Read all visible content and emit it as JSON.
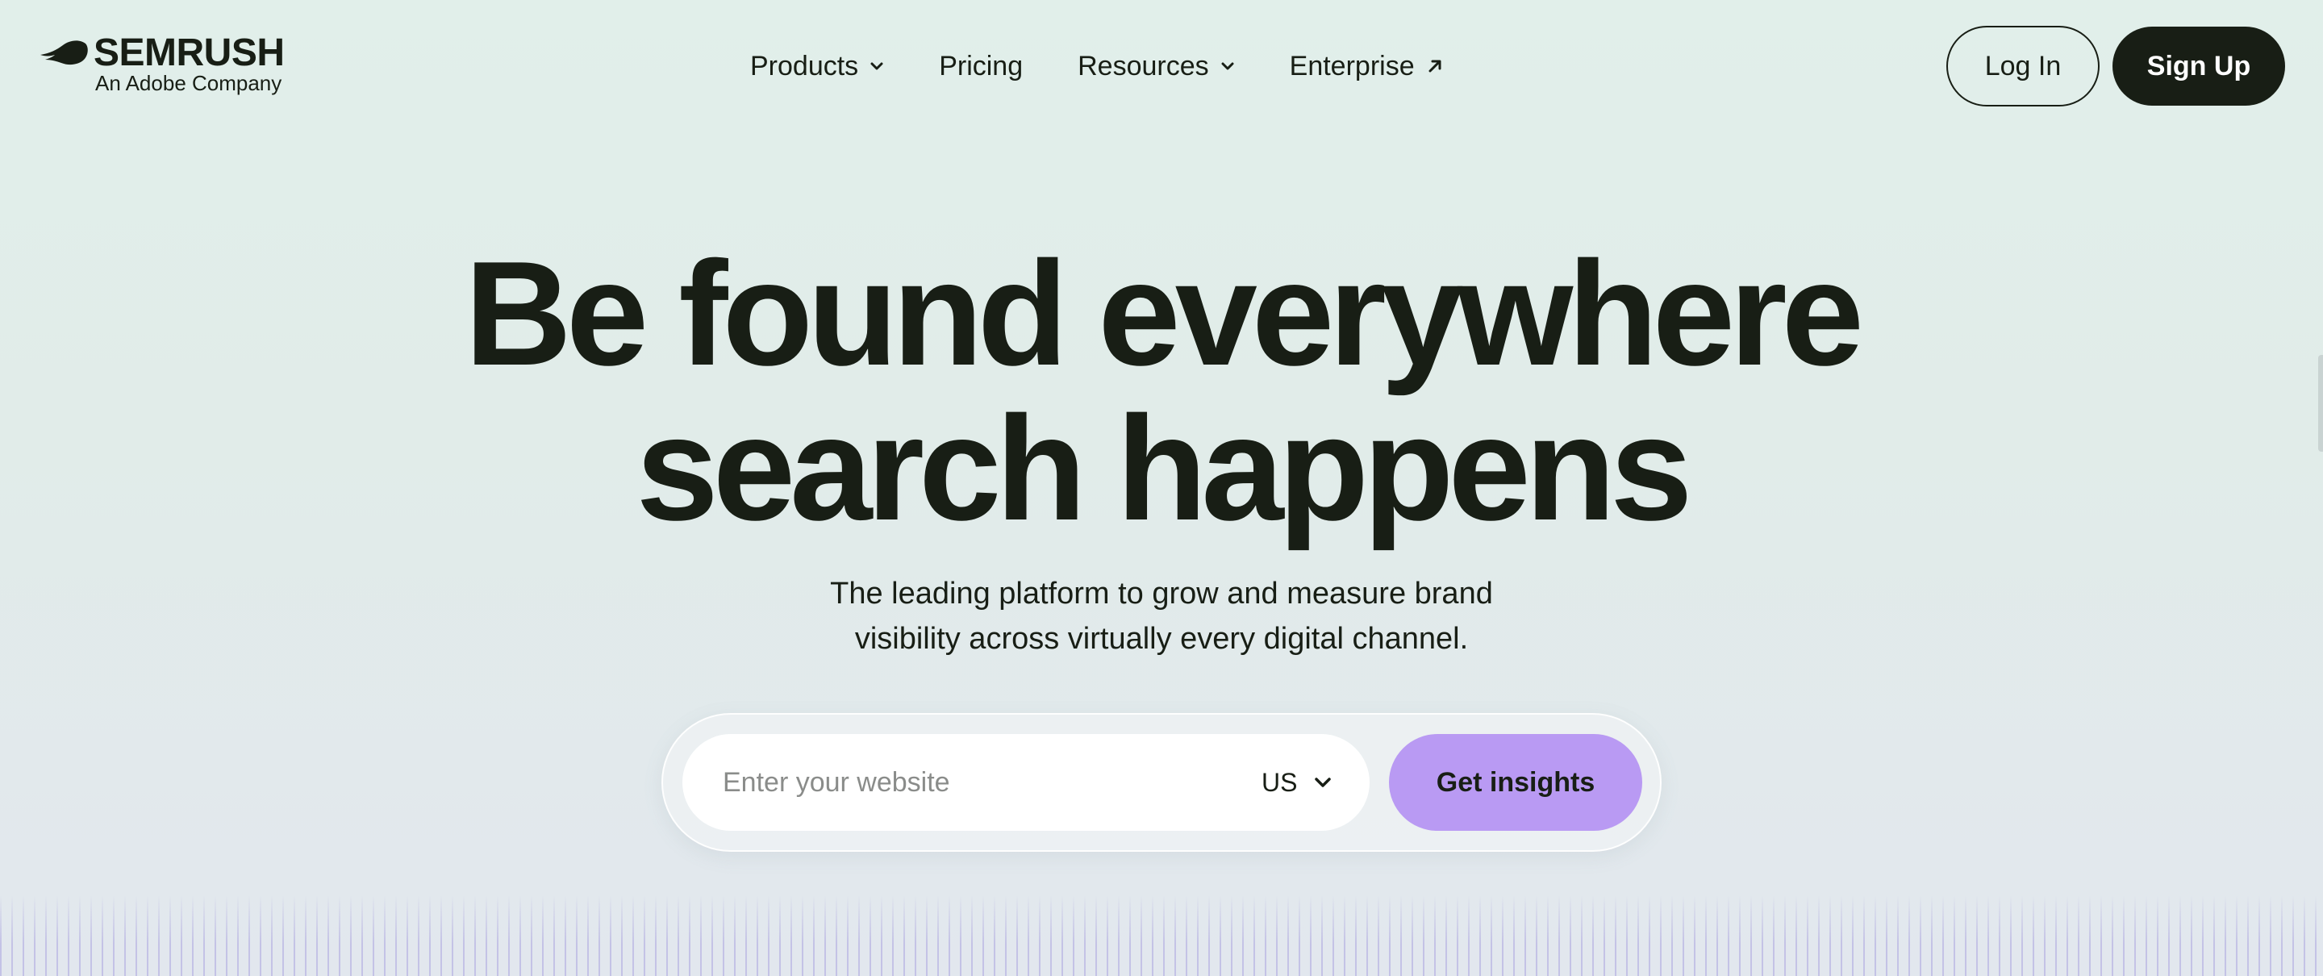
{
  "brand": {
    "name": "SEMRUSH",
    "tagline": "An Adobe Company"
  },
  "nav": {
    "items": [
      {
        "label": "Products",
        "icon": "chevron-down-icon"
      },
      {
        "label": "Pricing",
        "icon": null
      },
      {
        "label": "Resources",
        "icon": "chevron-down-icon"
      },
      {
        "label": "Enterprise",
        "icon": "arrow-up-right-icon"
      }
    ]
  },
  "auth": {
    "login_label": "Log In",
    "signup_label": "Sign Up"
  },
  "hero": {
    "title_line1": "Be found everywhere",
    "title_line2": "search happens",
    "subtitle_line1": "The leading platform to grow and measure brand",
    "subtitle_line2": "visibility across virtually every digital channel."
  },
  "search": {
    "placeholder": "Enter your website",
    "value": "",
    "country": "US",
    "submit_label": "Get insights"
  },
  "colors": {
    "primary_dark": "#181e15",
    "accent_purple": "#b99af3",
    "background_mint": "#e1efea"
  }
}
